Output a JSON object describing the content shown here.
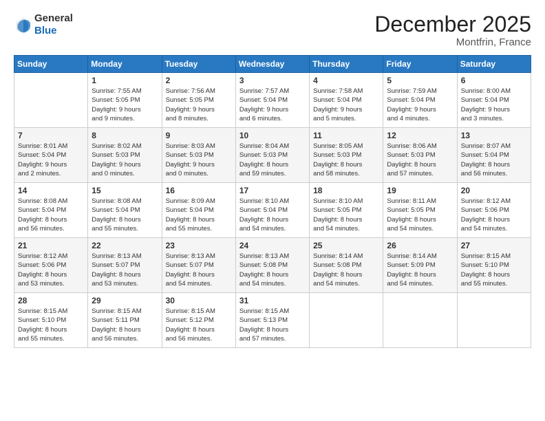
{
  "header": {
    "logo_line1": "General",
    "logo_line2": "Blue",
    "month": "December 2025",
    "location": "Montfrin, France"
  },
  "days_of_week": [
    "Sunday",
    "Monday",
    "Tuesday",
    "Wednesday",
    "Thursday",
    "Friday",
    "Saturday"
  ],
  "weeks": [
    [
      {
        "day": "",
        "info": ""
      },
      {
        "day": "1",
        "info": "Sunrise: 7:55 AM\nSunset: 5:05 PM\nDaylight: 9 hours\nand 9 minutes."
      },
      {
        "day": "2",
        "info": "Sunrise: 7:56 AM\nSunset: 5:05 PM\nDaylight: 9 hours\nand 8 minutes."
      },
      {
        "day": "3",
        "info": "Sunrise: 7:57 AM\nSunset: 5:04 PM\nDaylight: 9 hours\nand 6 minutes."
      },
      {
        "day": "4",
        "info": "Sunrise: 7:58 AM\nSunset: 5:04 PM\nDaylight: 9 hours\nand 5 minutes."
      },
      {
        "day": "5",
        "info": "Sunrise: 7:59 AM\nSunset: 5:04 PM\nDaylight: 9 hours\nand 4 minutes."
      },
      {
        "day": "6",
        "info": "Sunrise: 8:00 AM\nSunset: 5:04 PM\nDaylight: 9 hours\nand 3 minutes."
      }
    ],
    [
      {
        "day": "7",
        "info": "Sunrise: 8:01 AM\nSunset: 5:04 PM\nDaylight: 9 hours\nand 2 minutes."
      },
      {
        "day": "8",
        "info": "Sunrise: 8:02 AM\nSunset: 5:03 PM\nDaylight: 9 hours\nand 0 minutes."
      },
      {
        "day": "9",
        "info": "Sunrise: 8:03 AM\nSunset: 5:03 PM\nDaylight: 9 hours\nand 0 minutes."
      },
      {
        "day": "10",
        "info": "Sunrise: 8:04 AM\nSunset: 5:03 PM\nDaylight: 8 hours\nand 59 minutes."
      },
      {
        "day": "11",
        "info": "Sunrise: 8:05 AM\nSunset: 5:03 PM\nDaylight: 8 hours\nand 58 minutes."
      },
      {
        "day": "12",
        "info": "Sunrise: 8:06 AM\nSunset: 5:03 PM\nDaylight: 8 hours\nand 57 minutes."
      },
      {
        "day": "13",
        "info": "Sunrise: 8:07 AM\nSunset: 5:04 PM\nDaylight: 8 hours\nand 56 minutes."
      }
    ],
    [
      {
        "day": "14",
        "info": "Sunrise: 8:08 AM\nSunset: 5:04 PM\nDaylight: 8 hours\nand 56 minutes."
      },
      {
        "day": "15",
        "info": "Sunrise: 8:08 AM\nSunset: 5:04 PM\nDaylight: 8 hours\nand 55 minutes."
      },
      {
        "day": "16",
        "info": "Sunrise: 8:09 AM\nSunset: 5:04 PM\nDaylight: 8 hours\nand 55 minutes."
      },
      {
        "day": "17",
        "info": "Sunrise: 8:10 AM\nSunset: 5:04 PM\nDaylight: 8 hours\nand 54 minutes."
      },
      {
        "day": "18",
        "info": "Sunrise: 8:10 AM\nSunset: 5:05 PM\nDaylight: 8 hours\nand 54 minutes."
      },
      {
        "day": "19",
        "info": "Sunrise: 8:11 AM\nSunset: 5:05 PM\nDaylight: 8 hours\nand 54 minutes."
      },
      {
        "day": "20",
        "info": "Sunrise: 8:12 AM\nSunset: 5:06 PM\nDaylight: 8 hours\nand 54 minutes."
      }
    ],
    [
      {
        "day": "21",
        "info": "Sunrise: 8:12 AM\nSunset: 5:06 PM\nDaylight: 8 hours\nand 53 minutes."
      },
      {
        "day": "22",
        "info": "Sunrise: 8:13 AM\nSunset: 5:07 PM\nDaylight: 8 hours\nand 53 minutes."
      },
      {
        "day": "23",
        "info": "Sunrise: 8:13 AM\nSunset: 5:07 PM\nDaylight: 8 hours\nand 54 minutes."
      },
      {
        "day": "24",
        "info": "Sunrise: 8:13 AM\nSunset: 5:08 PM\nDaylight: 8 hours\nand 54 minutes."
      },
      {
        "day": "25",
        "info": "Sunrise: 8:14 AM\nSunset: 5:08 PM\nDaylight: 8 hours\nand 54 minutes."
      },
      {
        "day": "26",
        "info": "Sunrise: 8:14 AM\nSunset: 5:09 PM\nDaylight: 8 hours\nand 54 minutes."
      },
      {
        "day": "27",
        "info": "Sunrise: 8:15 AM\nSunset: 5:10 PM\nDaylight: 8 hours\nand 55 minutes."
      }
    ],
    [
      {
        "day": "28",
        "info": "Sunrise: 8:15 AM\nSunset: 5:10 PM\nDaylight: 8 hours\nand 55 minutes."
      },
      {
        "day": "29",
        "info": "Sunrise: 8:15 AM\nSunset: 5:11 PM\nDaylight: 8 hours\nand 56 minutes."
      },
      {
        "day": "30",
        "info": "Sunrise: 8:15 AM\nSunset: 5:12 PM\nDaylight: 8 hours\nand 56 minutes."
      },
      {
        "day": "31",
        "info": "Sunrise: 8:15 AM\nSunset: 5:13 PM\nDaylight: 8 hours\nand 57 minutes."
      },
      {
        "day": "",
        "info": ""
      },
      {
        "day": "",
        "info": ""
      },
      {
        "day": "",
        "info": ""
      }
    ]
  ]
}
